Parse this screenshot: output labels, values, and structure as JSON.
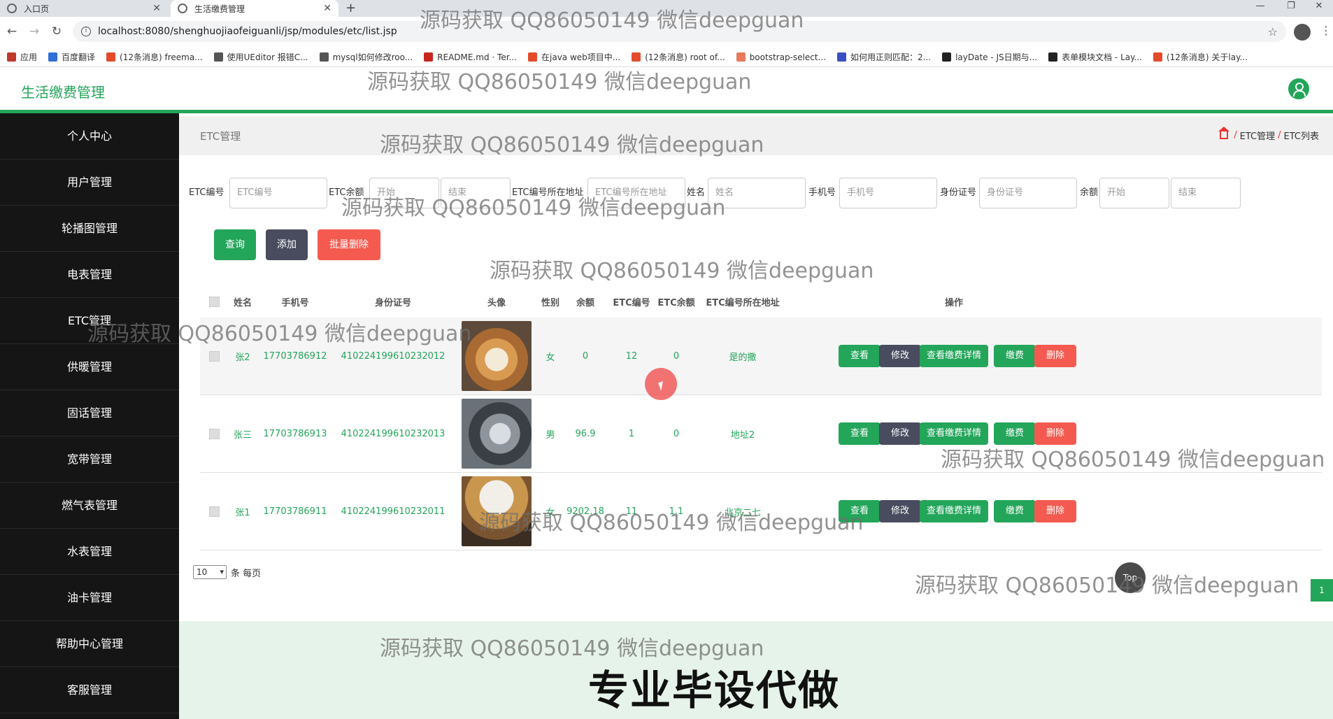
{
  "browser": {
    "tabs": [
      {
        "label": "入口页"
      },
      {
        "label": "生活缴费管理"
      }
    ],
    "url": "localhost:8080/shenghuojiaofeiguanli/jsp/modules/etc/list.jsp",
    "bookmarks": [
      {
        "label": "应用",
        "color": "#c0392b"
      },
      {
        "label": "百度翻译",
        "color": "#2f6fd6"
      },
      {
        "label": "(12条消息) freema...",
        "color": "#e34b2a"
      },
      {
        "label": "使用UEditor 报错C...",
        "color": "#555555"
      },
      {
        "label": "mysql如何修改roo...",
        "color": "#555555"
      },
      {
        "label": "README.md · Ter...",
        "color": "#c7261d"
      },
      {
        "label": "在java web项目中...",
        "color": "#e34b2a"
      },
      {
        "label": "(12条消息) root of...",
        "color": "#e34b2a"
      },
      {
        "label": "bootstrap-select...",
        "color": "#e77a5b"
      },
      {
        "label": "如何用正则匹配：2...",
        "color": "#3b4fc2"
      },
      {
        "label": "layDate - JS日期与...",
        "color": "#222222"
      },
      {
        "label": "表单模块文档 - Lay...",
        "color": "#222222"
      },
      {
        "label": "(12条消息) 关于lay...",
        "color": "#e34b2a"
      }
    ]
  },
  "header": {
    "title": "生活缴费管理"
  },
  "sidebar": {
    "items": [
      {
        "label": "个人中心"
      },
      {
        "label": "用户管理"
      },
      {
        "label": "轮播图管理"
      },
      {
        "label": "电表管理"
      },
      {
        "label": "ETC管理"
      },
      {
        "label": "供暖管理"
      },
      {
        "label": "固话管理"
      },
      {
        "label": "宽带管理"
      },
      {
        "label": "燃气表管理"
      },
      {
        "label": "水表管理"
      },
      {
        "label": "油卡管理"
      },
      {
        "label": "帮助中心管理"
      },
      {
        "label": "客服管理"
      }
    ]
  },
  "page": {
    "title": "ETC管理",
    "breadcrumb": [
      "ETC管理",
      "ETC列表"
    ]
  },
  "search": {
    "etc_no_label": "ETC编号",
    "etc_no_placeholder": "ETC编号",
    "etc_balance_label": "ETC余额",
    "etc_balance_start": "开始",
    "etc_balance_end": "结束",
    "etc_address_label": "ETC编号所在地址",
    "etc_address_placeholder": "ETC编号所在地址",
    "name_label": "姓名",
    "name_placeholder": "姓名",
    "phone_label": "手机号",
    "phone_placeholder": "手机号",
    "idcard_label": "身份证号",
    "idcard_placeholder": "身份证号",
    "balance_label": "余额",
    "balance_start": "开始",
    "balance_end": "结束"
  },
  "actions": {
    "query": "查询",
    "add": "添加",
    "batch_delete": "批量删除"
  },
  "table": {
    "headers": [
      "姓名",
      "手机号",
      "身份证号",
      "头像",
      "性别",
      "余额",
      "ETC编号",
      "ETC余额",
      "ETC编号所在地址",
      "操作"
    ],
    "row_actions": {
      "view": "查看",
      "edit": "修改",
      "view_payment": "查看缴费详情",
      "pay": "缴费",
      "delete": "删除"
    },
    "rows": [
      {
        "name": "张2",
        "phone": "17703786912",
        "idcard": "410224199610232012",
        "gender": "女",
        "balance": "0",
        "etc_no": "12",
        "etc_balance": "0",
        "address": "是的撒",
        "avatar": "shiba-dog-photo"
      },
      {
        "name": "张三",
        "phone": "17703786913",
        "idcard": "410224199610232013",
        "gender": "男",
        "balance": "96.9",
        "etc_no": "1",
        "etc_balance": "0",
        "address": "地址2",
        "avatar": "husky-dog-photo"
      },
      {
        "name": "张1",
        "phone": "17703786911",
        "idcard": "410224199610232011",
        "gender": "女",
        "balance": "9202.18",
        "etc_no": "11",
        "etc_balance": "1.1",
        "address": "北京二七",
        "avatar": "cat-with-hat-photo"
      }
    ]
  },
  "pagination": {
    "page_size": "10",
    "per_page_label": "条 每页",
    "current_page": "1"
  },
  "footer": {
    "promo": "专业毕设代做",
    "top_button": "Top"
  },
  "watermark": "源码获取 QQ86050149 微信deepguan",
  "colors": {
    "accent": "#23a55a",
    "sidebar_bg": "#151515",
    "danger": "#f45a4f",
    "dark_button": "#494c5e"
  }
}
